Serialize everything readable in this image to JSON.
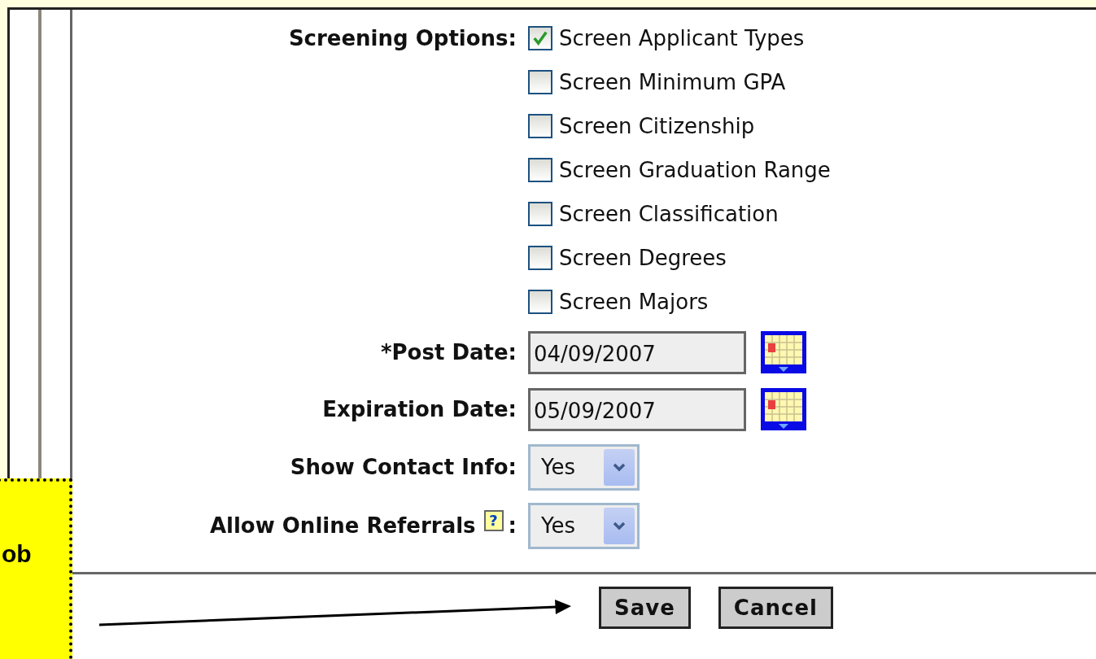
{
  "screening": {
    "label": "Screening Options:",
    "options": [
      {
        "label": "Screen Applicant Types",
        "checked": true
      },
      {
        "label": "Screen Minimum GPA",
        "checked": false
      },
      {
        "label": "Screen Citizenship",
        "checked": false
      },
      {
        "label": "Screen Graduation Range",
        "checked": false
      },
      {
        "label": "Screen Classification",
        "checked": false
      },
      {
        "label": "Screen Degrees",
        "checked": false
      },
      {
        "label": "Screen Majors",
        "checked": false
      }
    ]
  },
  "dates": [
    {
      "label": "*Post Date:",
      "value": "04/09/2007"
    },
    {
      "label": "Expiration Date:",
      "value": "05/09/2007"
    }
  ],
  "selects": [
    {
      "label": "Show Contact Info:",
      "value": "Yes"
    },
    {
      "label": "Allow Online Referrals",
      "help": "?",
      "suffix": ":",
      "value": "Yes"
    }
  ],
  "buttons": [
    "Save",
    "Cancel"
  ],
  "callout": {
    "text": "ob"
  }
}
